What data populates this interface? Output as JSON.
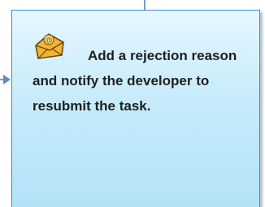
{
  "step": {
    "icon": "email-envelope-icon",
    "text": "Add a rejection reason and notify the developer to resubmit the task."
  },
  "colors": {
    "box_border": "#4a87c0",
    "box_fill_top": "#e6f7ff",
    "box_fill_bottom": "#b2e2f8",
    "connector": "#7a9cc6",
    "icon_fill": "#f4b431"
  }
}
